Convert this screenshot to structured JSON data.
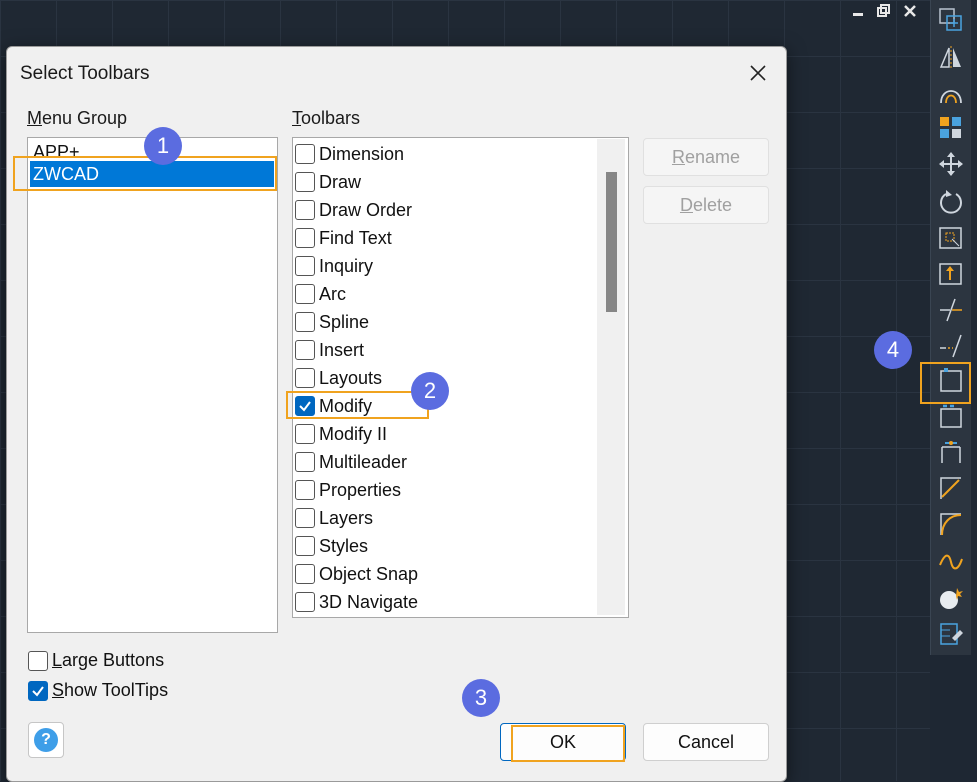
{
  "dialog": {
    "title": "Select Toolbars",
    "menu_group_label": "Menu Group",
    "menu_group_label_mnemonic": "M",
    "menu_group_label_rest": "enu Group",
    "toolbars_label_mnemonic": "T",
    "toolbars_label_rest": "oolbars",
    "menu_groups": [
      {
        "label": "APP+",
        "selected": false
      },
      {
        "label": "ZWCAD",
        "selected": true
      }
    ],
    "toolbars": [
      {
        "label": "Dimension",
        "checked": false
      },
      {
        "label": "Draw",
        "checked": false
      },
      {
        "label": "Draw Order",
        "checked": false
      },
      {
        "label": "Find Text",
        "checked": false
      },
      {
        "label": "Inquiry",
        "checked": false
      },
      {
        "label": "Arc",
        "checked": false
      },
      {
        "label": "Spline",
        "checked": false
      },
      {
        "label": "Insert",
        "checked": false
      },
      {
        "label": "Layouts",
        "checked": false
      },
      {
        "label": "Modify",
        "checked": true
      },
      {
        "label": "Modify II",
        "checked": false
      },
      {
        "label": "Multileader",
        "checked": false
      },
      {
        "label": "Properties",
        "checked": false
      },
      {
        "label": "Layers",
        "checked": false
      },
      {
        "label": "Styles",
        "checked": false
      },
      {
        "label": "Object Snap",
        "checked": false
      },
      {
        "label": "3D Navigate",
        "checked": false
      }
    ],
    "rename_mnemonic": "R",
    "rename_rest": "ename",
    "delete_mnemonic": "D",
    "delete_rest": "elete",
    "large_buttons_mnemonic": "L",
    "large_buttons_rest": "arge Buttons",
    "large_buttons_checked": false,
    "show_tooltips_mnemonic": "S",
    "show_tooltips_rest": "how ToolTips",
    "show_tooltips_checked": true,
    "help_glyph": "?",
    "ok_label": "OK",
    "cancel_label": "Cancel"
  },
  "annotations": [
    "1",
    "2",
    "3",
    "4"
  ],
  "window_controls": [
    "minimize-icon",
    "restore-icon",
    "close-icon"
  ],
  "right_toolbar_icons": [
    "copy-icon",
    "mirror-icon",
    "offset-icon",
    "array-icon",
    "move-icon",
    "rotate-icon",
    "scale-icon",
    "stretch-icon",
    "trim-icon",
    "extend-icon",
    "break-at-point-icon",
    "break-icon",
    "join-icon",
    "chamfer-icon",
    "fillet-icon",
    "blend-curves-icon",
    "explode-icon",
    "edit-hatch-icon"
  ],
  "colors": {
    "accent": "#0078d7",
    "highlight": "#f0a31f",
    "badge": "#5b6ce0",
    "canvas": "#1f2833"
  }
}
